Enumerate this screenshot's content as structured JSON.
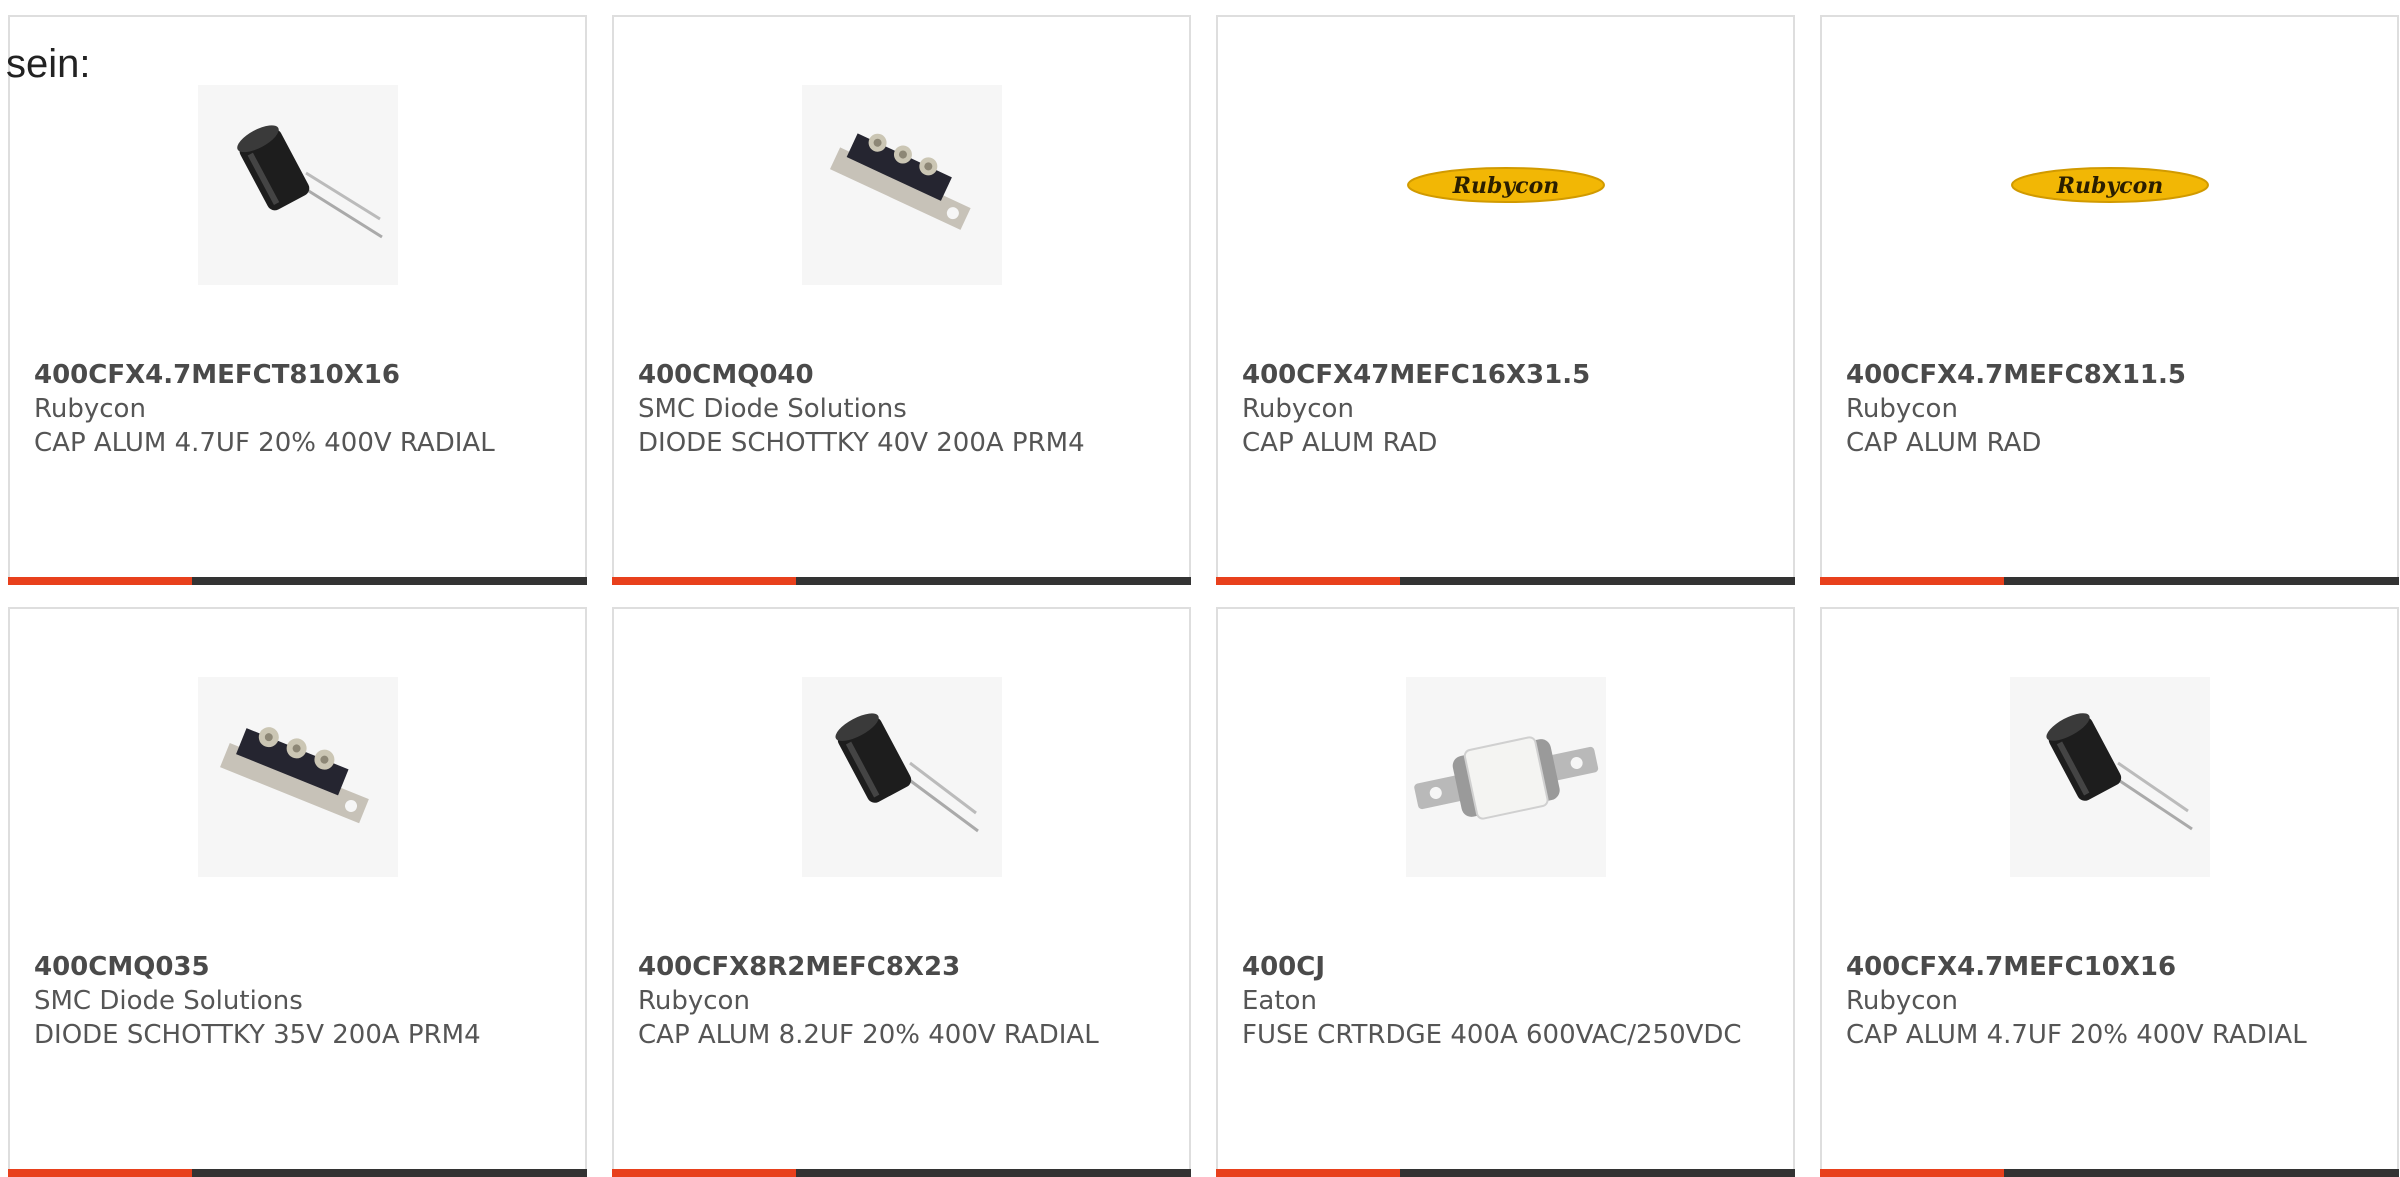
{
  "intro_text": "sein:",
  "colors": {
    "accent": "#e8401c",
    "bar": "#333333",
    "border": "#dedede",
    "logo_yellow": "#f2b705"
  },
  "products": [
    {
      "part_number": "400CFX4.7MEFCT810X16",
      "manufacturer": "Rubycon",
      "description": "CAP ALUM 4.7UF 20% 400V RADIAL",
      "image": "radial-capacitor-icon"
    },
    {
      "part_number": "400CMQ040",
      "manufacturer": "SMC Diode Solutions",
      "description": "DIODE SCHOTTKY 40V 200A PRM4",
      "image": "diode-module-icon"
    },
    {
      "part_number": "400CFX47MEFC16X31.5",
      "manufacturer": "Rubycon",
      "description": "CAP ALUM RAD",
      "image": "rubycon-logo",
      "logo_text": "Rubycon"
    },
    {
      "part_number": "400CFX4.7MEFC8X11.5",
      "manufacturer": "Rubycon",
      "description": "CAP ALUM RAD",
      "image": "rubycon-logo",
      "logo_text": "Rubycon"
    },
    {
      "part_number": "400CMQ035",
      "manufacturer": "SMC Diode Solutions",
      "description": "DIODE SCHOTTKY 35V 200A PRM4",
      "image": "diode-module-icon"
    },
    {
      "part_number": "400CFX8R2MEFC8X23",
      "manufacturer": "Rubycon",
      "description": "CAP ALUM 8.2UF 20% 400V RADIAL",
      "image": "radial-capacitor-icon"
    },
    {
      "part_number": "400CJ",
      "manufacturer": "Eaton",
      "description": "FUSE CRTRDGE 400A 600VAC/250VDC",
      "image": "cartridge-fuse-icon"
    },
    {
      "part_number": "400CFX4.7MEFC10X16",
      "manufacturer": "Rubycon",
      "description": "CAP ALUM 4.7UF 20% 400V RADIAL",
      "image": "radial-capacitor-icon"
    }
  ]
}
